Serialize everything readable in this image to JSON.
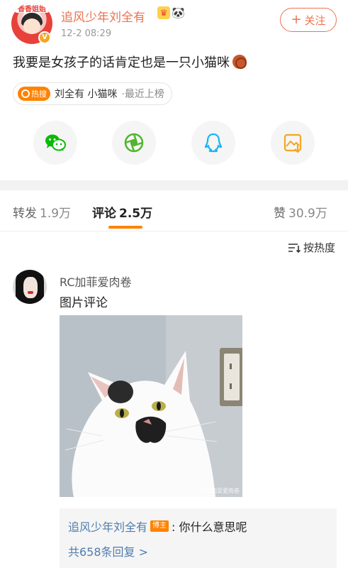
{
  "post": {
    "avatar_banner_text": "香香姐姐",
    "author": "追风少年刘全有",
    "time": "12-2 08:29",
    "follow_label": "关注",
    "text": "我要是女孩子的话肯定也是一只小猫咪",
    "hot_tag": {
      "badge_label": "热搜",
      "title": "刘全有 小猫咪",
      "suffix": "·最近上榜"
    }
  },
  "share": {
    "items": [
      {
        "name": "wechat",
        "icon": "wechat-icon",
        "color": "#09bb07"
      },
      {
        "name": "moments",
        "icon": "moments-icon",
        "color": "#50b62b"
      },
      {
        "name": "qq",
        "icon": "qq-icon",
        "color": "#12b7f5"
      },
      {
        "name": "save-image",
        "icon": "save-image-icon",
        "color": "#f5a623"
      }
    ]
  },
  "tabs": {
    "repost": {
      "label": "转发",
      "count": "1.9万"
    },
    "comment": {
      "label": "评论",
      "count": "2.5万"
    },
    "like": {
      "label": "赞",
      "count": "30.9万"
    }
  },
  "sort": {
    "label": "按热度"
  },
  "comment": {
    "author": "RC加菲爱肉卷",
    "text": "图片评论",
    "image_watermark": "@RC加菲爱肉卷",
    "reply": {
      "author": "追风少年刘全有",
      "badge": "博主",
      "text": ": 你什么意思呢",
      "count_label": "共658条回复 >"
    }
  },
  "colors": {
    "accent": "#eb7350",
    "link": "#507daf",
    "hot": "#ff8200"
  }
}
